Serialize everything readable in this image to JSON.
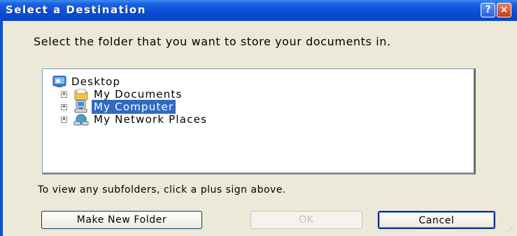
{
  "window": {
    "title": "Select a Destination",
    "help_glyph": "?",
    "close_glyph": "×"
  },
  "prompt": "Select the folder that you want to store your documents in.",
  "tree": {
    "items": [
      {
        "label": "Desktop",
        "icon": "desktop-icon",
        "expandable": false,
        "selected": false
      },
      {
        "label": "My Documents",
        "icon": "folder-icon",
        "expandable": true,
        "selected": false
      },
      {
        "label": "My Computer",
        "icon": "computer-icon",
        "expandable": true,
        "selected": true
      },
      {
        "label": "My Network Places",
        "icon": "network-icon",
        "expandable": true,
        "selected": false
      }
    ],
    "expand_glyph": "+"
  },
  "hint": "To view any subfolders, click a plus sign above.",
  "buttons": {
    "make_new_folder": "Make New Folder",
    "ok": "OK",
    "cancel": "Cancel"
  },
  "colors": {
    "titlebar": "#0a4fd8",
    "selection": "#316ac5",
    "dialog_bg": "#ece9d8"
  }
}
